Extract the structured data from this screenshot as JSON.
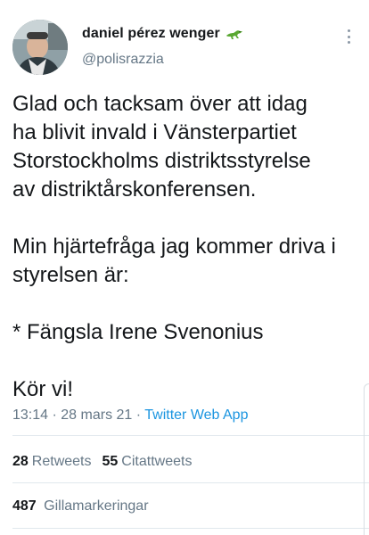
{
  "author": {
    "display_name": "daniel pérez wenger",
    "handle": "@polisrazzia",
    "emoji_icon": "lizard-icon"
  },
  "tweet": {
    "paragraphs": [
      "Glad och tacksam över att idag\nha blivit invald i Vänsterpartiet\nStorstockholms distriktsstyrelse\nav distriktårskonferensen.",
      "Min hjärtefråga jag kommer driva i\nstyrelsen är:",
      "* Fängsla Irene Svenonius",
      "Kör vi!"
    ]
  },
  "meta": {
    "time": "13:14",
    "separator": "·",
    "date": "28 mars 21",
    "source": "Twitter Web App"
  },
  "stats": {
    "retweets_count": "28",
    "retweets_label": "Retweets",
    "quotes_count": "55",
    "quotes_label": "Citattweets",
    "likes_count": "487",
    "likes_label": "Gillamarkeringar"
  },
  "colors": {
    "text": "#14171a",
    "secondary": "#657786",
    "link": "#1b95e0",
    "divider": "#e1e8ed"
  }
}
